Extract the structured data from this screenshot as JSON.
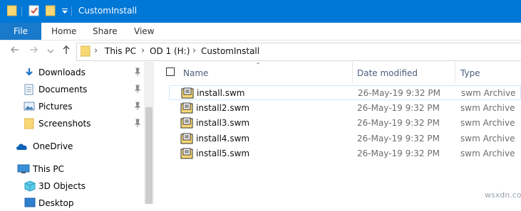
{
  "window": {
    "title": "CustomInstall"
  },
  "ribbon": {
    "tabs": [
      "File",
      "Home",
      "Share",
      "View"
    ]
  },
  "address": {
    "path": [
      "This PC",
      "OD 1 (H:)",
      "CustomInstall"
    ]
  },
  "nav": {
    "quick_access": [
      {
        "label": "Downloads",
        "icon": "download-icon",
        "pinned": true
      },
      {
        "label": "Documents",
        "icon": "documents-icon",
        "pinned": true
      },
      {
        "label": "Pictures",
        "icon": "pictures-icon",
        "pinned": true
      },
      {
        "label": "Screenshots",
        "icon": "folder-icon",
        "pinned": true
      }
    ],
    "onedrive": "OneDrive",
    "this_pc": "This PC",
    "this_pc_children": [
      "3D Objects",
      "Desktop"
    ]
  },
  "list": {
    "columns": {
      "name": "Name",
      "date": "Date modified",
      "type": "Type"
    },
    "rows": [
      {
        "name": "install.swm",
        "date": "26-May-19 9:32 PM",
        "type": "swm Archive"
      },
      {
        "name": "install2.swm",
        "date": "26-May-19 9:32 PM",
        "type": "swm Archive"
      },
      {
        "name": "install3.swm",
        "date": "26-May-19 9:32 PM",
        "type": "swm Archive"
      },
      {
        "name": "install4.swm",
        "date": "26-May-19 9:32 PM",
        "type": "swm Archive"
      },
      {
        "name": "install5.swm",
        "date": "26-May-19 9:32 PM",
        "type": "swm Archive"
      }
    ]
  },
  "watermark": "wsxdn.com",
  "colors": {
    "titlebar": "#0078d7",
    "file_tab": "#1979ca",
    "folder": "#f8d775",
    "selection_border": "#cce8ff"
  }
}
